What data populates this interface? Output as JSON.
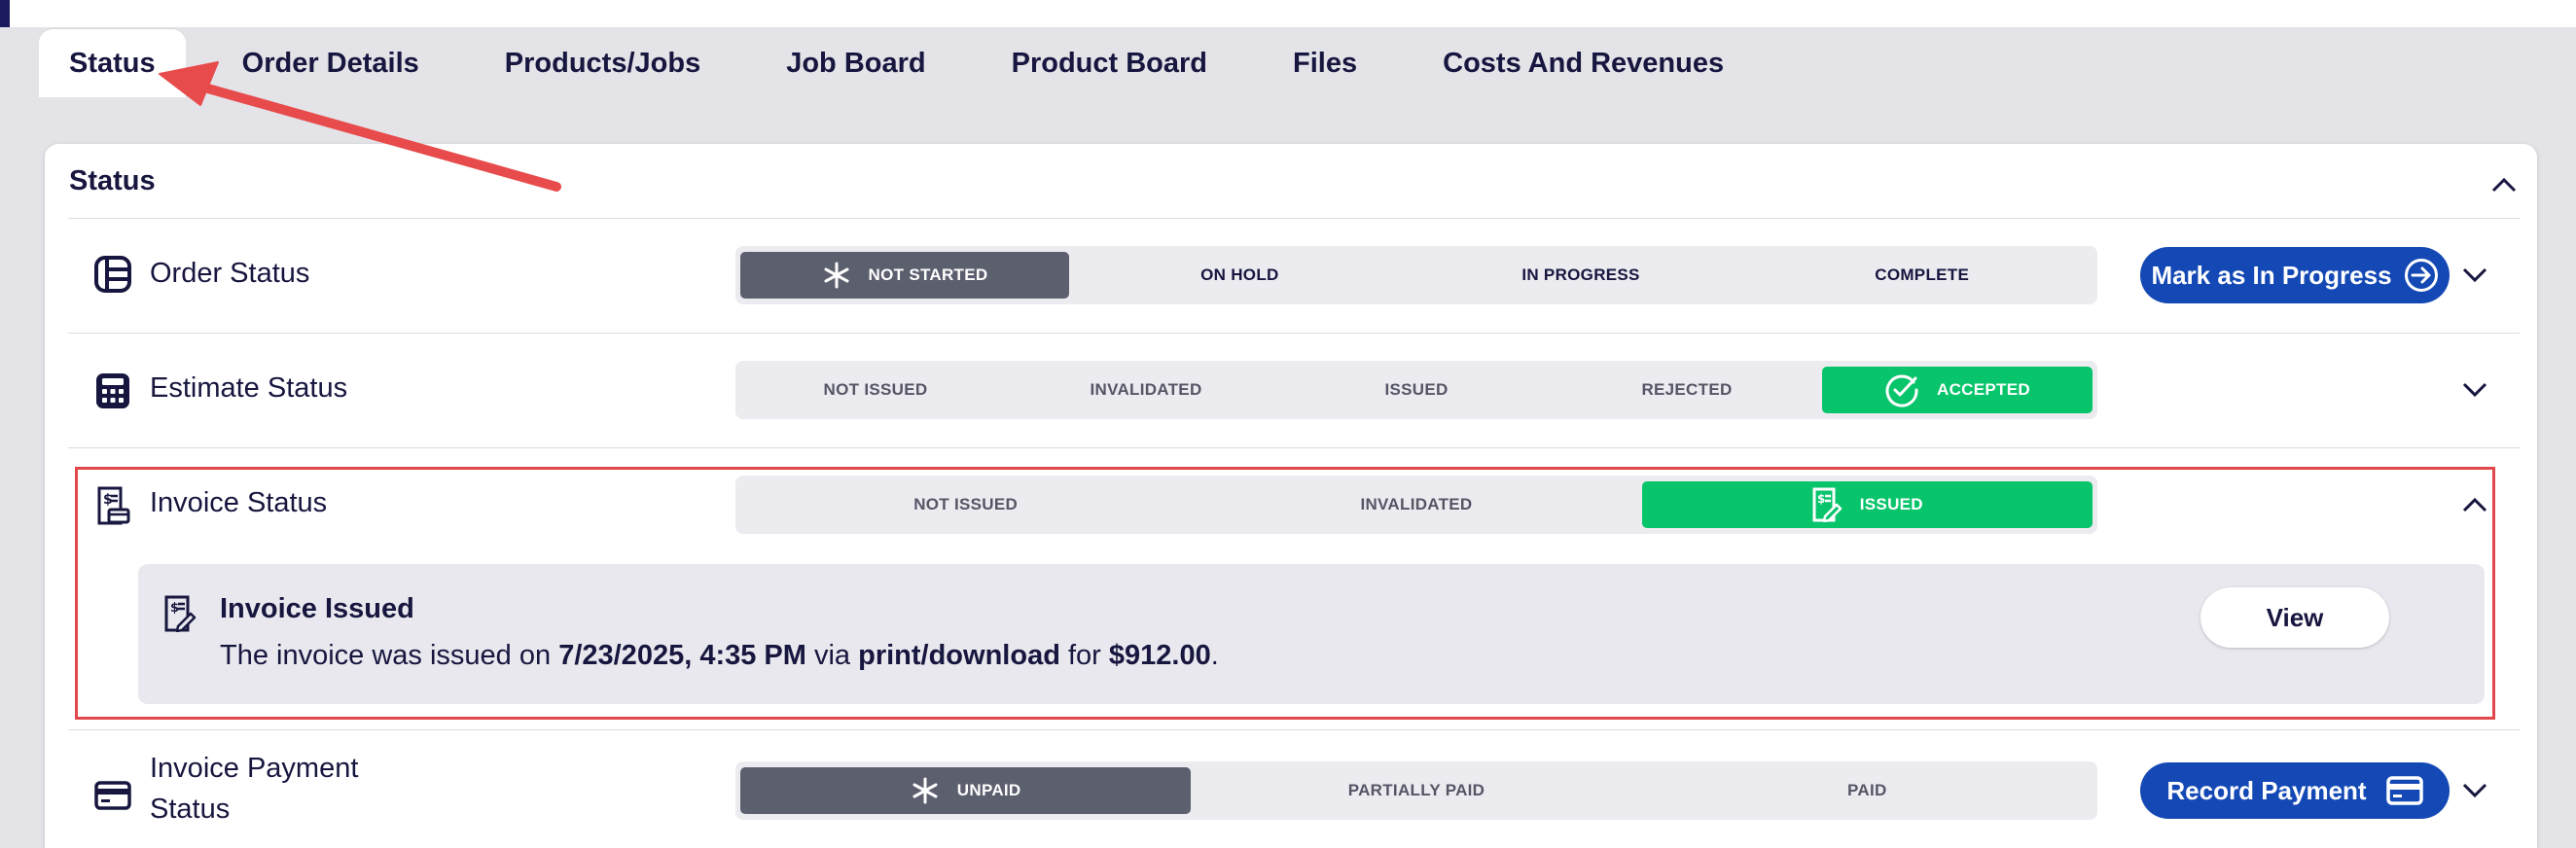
{
  "tabs": [
    {
      "label": "Status",
      "active": true
    },
    {
      "label": "Order Details"
    },
    {
      "label": "Products/Jobs"
    },
    {
      "label": "Job Board"
    },
    {
      "label": "Product Board"
    },
    {
      "label": "Files"
    },
    {
      "label": "Costs And Revenues"
    }
  ],
  "card": {
    "title": "Status"
  },
  "order_status": {
    "label": "Order Status",
    "segments": [
      "NOT STARTED",
      "ON HOLD",
      "IN PROGRESS",
      "COMPLETE"
    ],
    "selected": "NOT STARTED",
    "action_label": "Mark as In Progress"
  },
  "estimate_status": {
    "label": "Estimate Status",
    "segments": [
      "NOT ISSUED",
      "INVALIDATED",
      "ISSUED",
      "REJECTED",
      "ACCEPTED"
    ],
    "selected": "ACCEPTED"
  },
  "invoice_status": {
    "label": "Invoice Status",
    "segments": [
      "NOT ISSUED",
      "INVALIDATED",
      "ISSUED"
    ],
    "selected": "ISSUED",
    "detail": {
      "title": "Invoice Issued",
      "text_prefix": "The invoice was issued on ",
      "date": "7/23/2025, 4:35 PM",
      "text_via": " via ",
      "method": "print/download",
      "text_for": " for ",
      "amount": "$912.00",
      "text_end": ".",
      "view_label": "View"
    }
  },
  "payment_status": {
    "label_line1": "Invoice Payment",
    "label_line2": "Status",
    "segments": [
      "UNPAID",
      "PARTIALLY PAID",
      "PAID"
    ],
    "selected": "UNPAID",
    "action_label": "Record Payment"
  },
  "colors": {
    "primary": "#1449b5",
    "selected_gray": "#5c5f6e",
    "selected_green": "#08c46b",
    "annotation_red": "#e0464a"
  }
}
